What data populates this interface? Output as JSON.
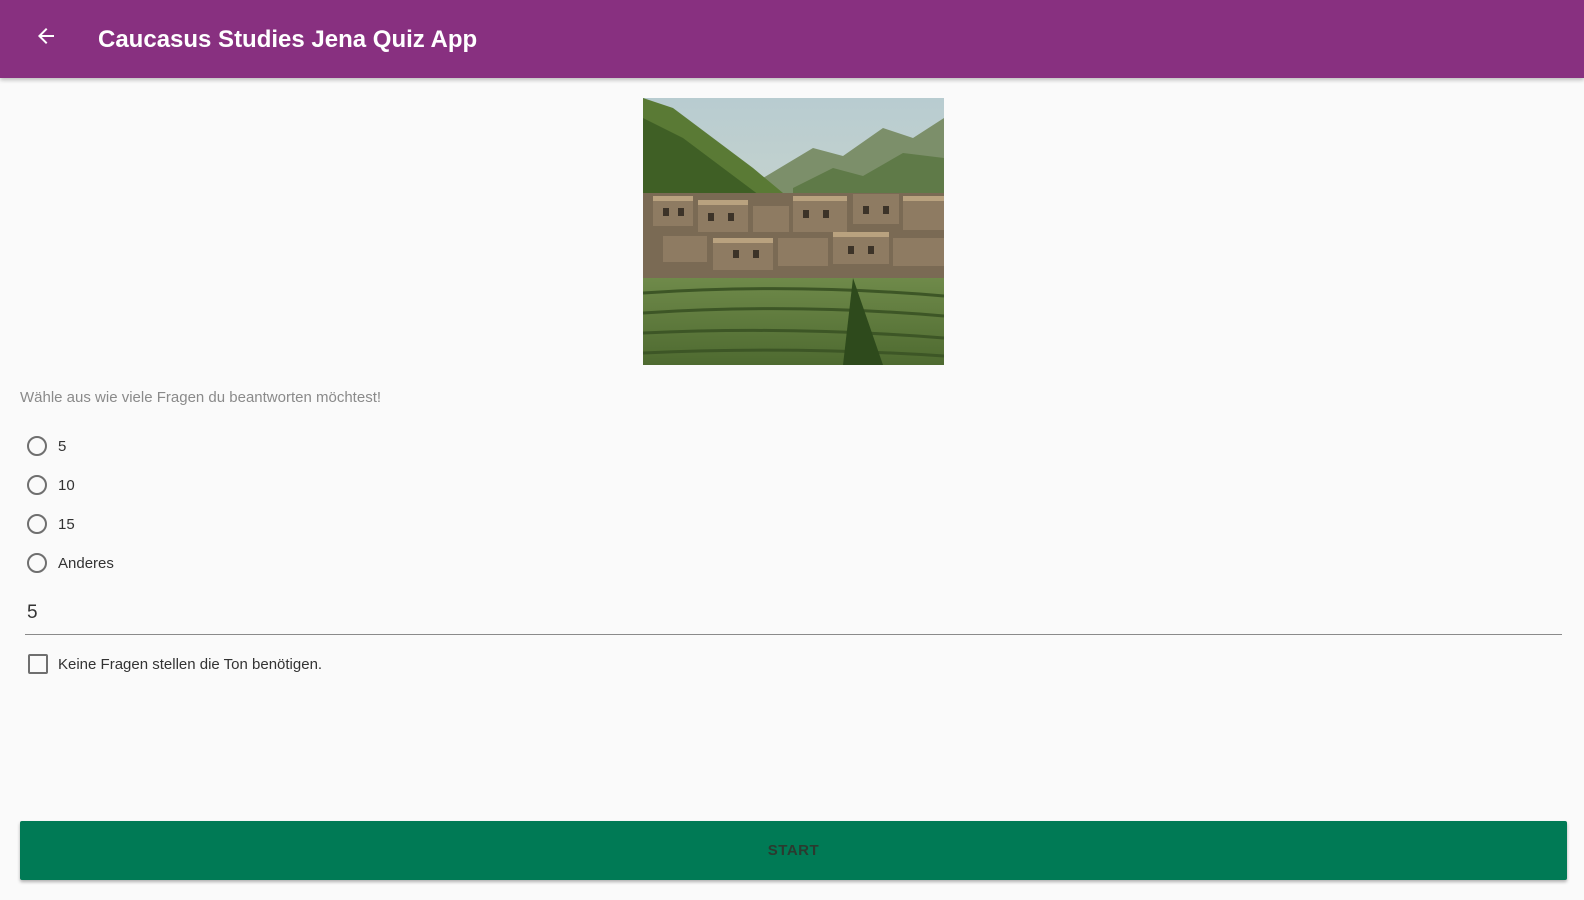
{
  "colors": {
    "appbar": "#883080",
    "start_button": "#007a55",
    "background": "#fafafa"
  },
  "appbar": {
    "title": "Caucasus Studies Jena Quiz App",
    "back_icon": "arrow-back-icon"
  },
  "hero_image": {
    "description_icon": "mountain-village-photo"
  },
  "quiz_setup": {
    "prompt": "Wähle aus wie viele Fragen du beantworten möchtest!",
    "options": [
      {
        "label": "5",
        "selected": false
      },
      {
        "label": "10",
        "selected": false
      },
      {
        "label": "15",
        "selected": false
      },
      {
        "label": "Anderes",
        "selected": false
      }
    ],
    "question_count_value": "5",
    "no_sound_checkbox": {
      "label": "Keine Fragen stellen die Ton benötigen.",
      "checked": false
    },
    "start_label": "START"
  }
}
